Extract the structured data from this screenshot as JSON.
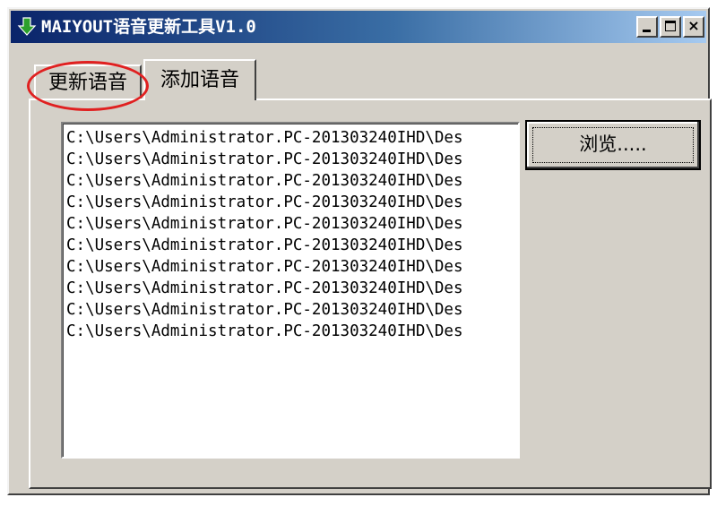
{
  "window": {
    "title": "MAIYOUT语音更新工具V1.0",
    "controls": {
      "minimize": "minimize-icon",
      "maximize": "maximize-icon",
      "close": "×"
    }
  },
  "tabs": [
    {
      "label": "更新语音",
      "selected": false,
      "highlighted": true
    },
    {
      "label": "添加语音",
      "selected": true
    }
  ],
  "file_list": {
    "items": [
      "C:\\Users\\Administrator.PC-201303240IHD\\Des",
      "C:\\Users\\Administrator.PC-201303240IHD\\Des",
      "C:\\Users\\Administrator.PC-201303240IHD\\Des",
      "C:\\Users\\Administrator.PC-201303240IHD\\Des",
      "C:\\Users\\Administrator.PC-201303240IHD\\Des",
      "C:\\Users\\Administrator.PC-201303240IHD\\Des",
      "C:\\Users\\Administrator.PC-201303240IHD\\Des",
      "C:\\Users\\Administrator.PC-201303240IHD\\Des",
      "C:\\Users\\Administrator.PC-201303240IHD\\Des",
      "C:\\Users\\Administrator.PC-201303240IHD\\Des"
    ]
  },
  "browse_button": {
    "label": "浏览....."
  },
  "colors": {
    "titlebar_start": "#0a246a",
    "titlebar_end": "#a6caf0",
    "face": "#d4d0c8",
    "highlight_ring": "#e02020"
  }
}
